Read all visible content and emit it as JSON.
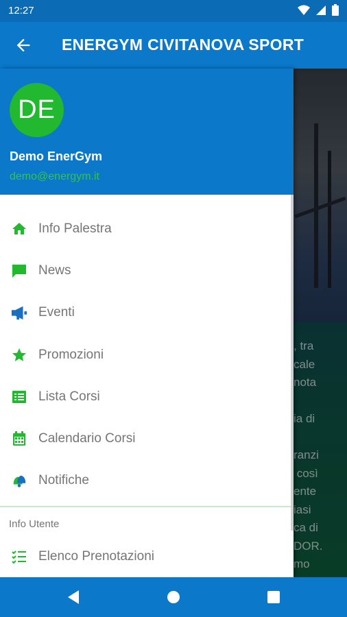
{
  "status_bar": {
    "time": "12:27"
  },
  "app_bar": {
    "title": "ENERGYM CIVITANOVA SPORT"
  },
  "drawer": {
    "avatar_initials": "DE",
    "user_name": "Demo EnerGym",
    "user_email": "demo@energym.it",
    "menu": [
      {
        "label": "Info Palestra",
        "icon": "home-icon"
      },
      {
        "label": "News",
        "icon": "chat-icon"
      },
      {
        "label": "Eventi",
        "icon": "megaphone-icon"
      },
      {
        "label": "Promozioni",
        "icon": "star-icon"
      },
      {
        "label": "Lista Corsi",
        "icon": "list-card-icon"
      },
      {
        "label": "Calendario Corsi",
        "icon": "calendar-icon"
      },
      {
        "label": "Notifiche",
        "icon": "bell-icon"
      }
    ],
    "section_label": "Info Utente",
    "user_menu": [
      {
        "label": "Elenco Prenotazioni",
        "icon": "checklist-icon"
      }
    ]
  },
  "background_text": ", tra\ncale\nnota\n\nia di\n\nranzi\n così\nente\niasi\nca di\nDOR.\nmo\n ",
  "colors": {
    "primary": "#0b78c9",
    "accent_green": "#22b82f",
    "menu_text": "#757575"
  }
}
